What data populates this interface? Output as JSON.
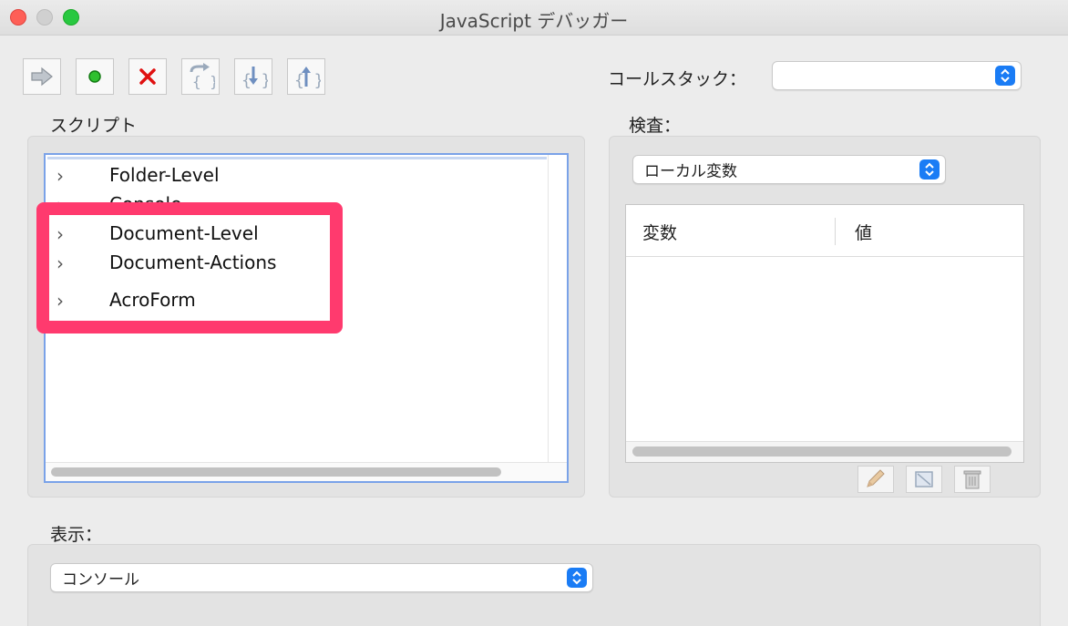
{
  "window": {
    "title": "JavaScript デバッガー"
  },
  "toolbar": {
    "buttons": [
      {
        "name": "resume",
        "icon": "arrow-right-icon"
      },
      {
        "name": "pause",
        "icon": "green-dot-icon"
      },
      {
        "name": "quit",
        "icon": "red-x-icon"
      },
      {
        "name": "step-over",
        "icon": "step-over-icon"
      },
      {
        "name": "step-into",
        "icon": "step-into-icon"
      },
      {
        "name": "step-out",
        "icon": "step-out-icon"
      }
    ]
  },
  "callstack": {
    "label": "コールスタック：",
    "value": ""
  },
  "scripts": {
    "label": "スクリプト",
    "items": [
      {
        "label": "Folder-Level"
      },
      {
        "label": "Console"
      },
      {
        "label": "Document-Level"
      },
      {
        "label": "Document-Actions"
      },
      {
        "label": "AcroForm"
      }
    ]
  },
  "inspect": {
    "label": "検査：",
    "scope_value": "ローカル変数",
    "columns": [
      "変数",
      "値"
    ],
    "buttons": [
      {
        "name": "edit",
        "icon": "pencil-icon"
      },
      {
        "name": "watch",
        "icon": "frame-icon"
      },
      {
        "name": "delete",
        "icon": "trash-icon"
      }
    ]
  },
  "view": {
    "label": "表示：",
    "value": "コンソール"
  },
  "colors": {
    "highlight": "#ff3a6e",
    "accent": "#1a7cf5"
  }
}
